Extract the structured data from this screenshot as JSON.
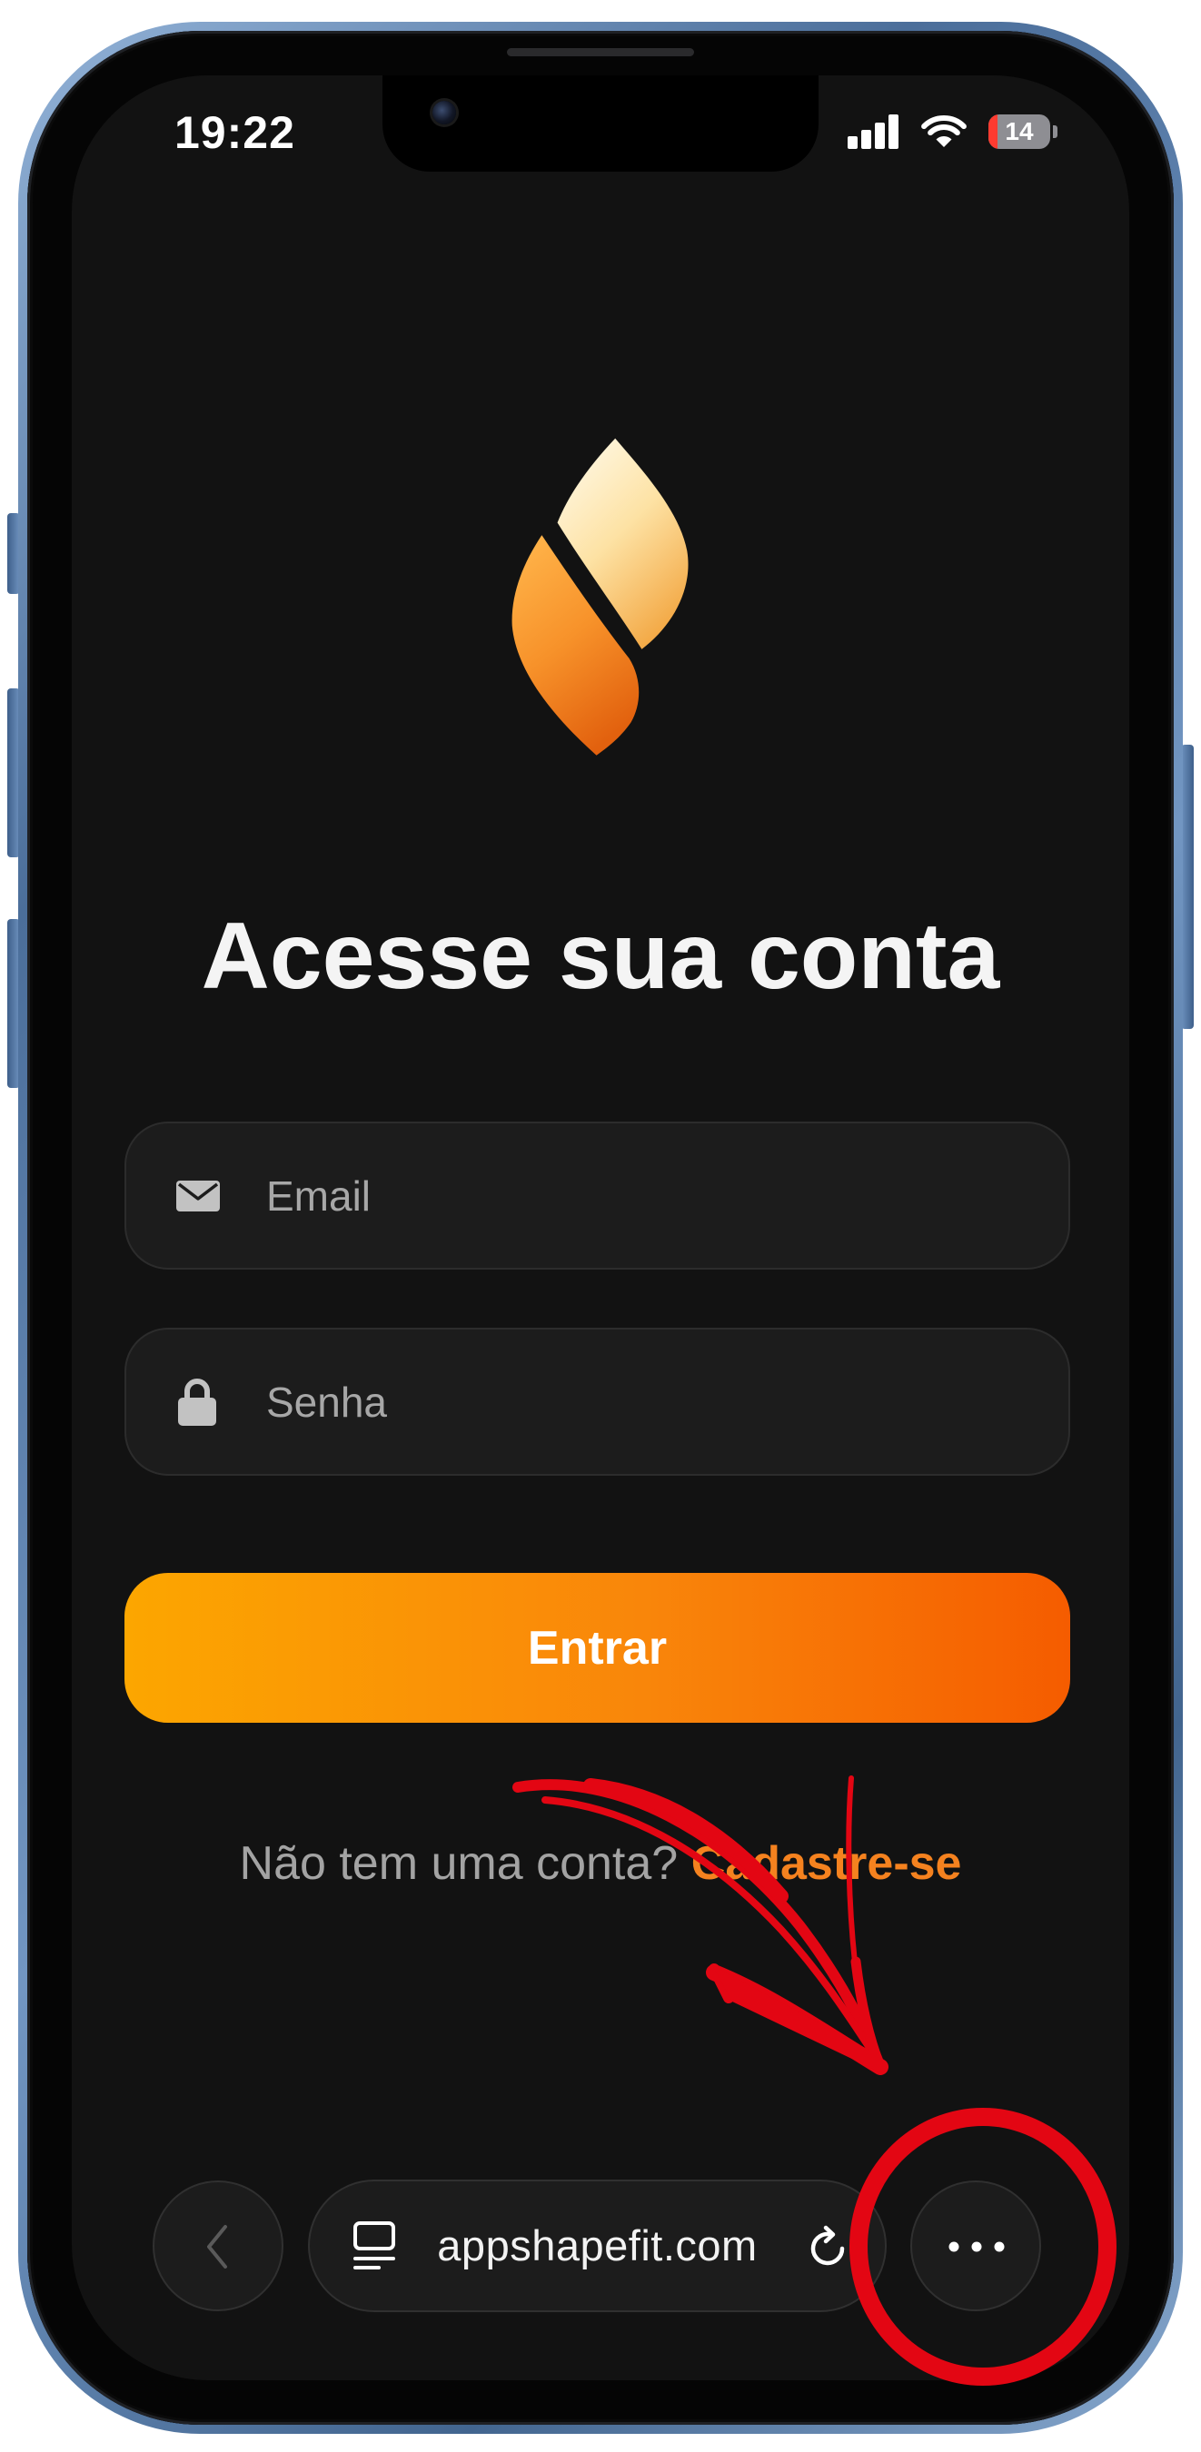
{
  "status_bar": {
    "time": "19:22",
    "battery_level": "14",
    "icons": {
      "signal": "cellular-signal-icon",
      "wifi": "wifi-icon",
      "battery": "battery-icon"
    }
  },
  "login": {
    "logo": "flame-logo",
    "title": "Acesse sua conta",
    "email_field": {
      "placeholder": "Email",
      "icon": "envelope-icon"
    },
    "password_field": {
      "placeholder": "Senha",
      "icon": "lock-icon"
    },
    "submit_label": "Entrar",
    "signup_prompt": "Não tem uma conta?",
    "signup_link": "Cadastre-se"
  },
  "browser_toolbar": {
    "url": "appshapefit.com",
    "icons": {
      "back": "chevron-left-icon",
      "page_menu": "page-menu-icon",
      "reload": "reload-icon",
      "more": "more-dots-icon"
    }
  },
  "theme": {
    "screen_background": "#121212",
    "accent": "#f5821f",
    "button_gradient_start": "#fca600",
    "button_gradient_end": "#f55c00",
    "annotation": "#e30613",
    "frame": "#5b7ea9"
  }
}
